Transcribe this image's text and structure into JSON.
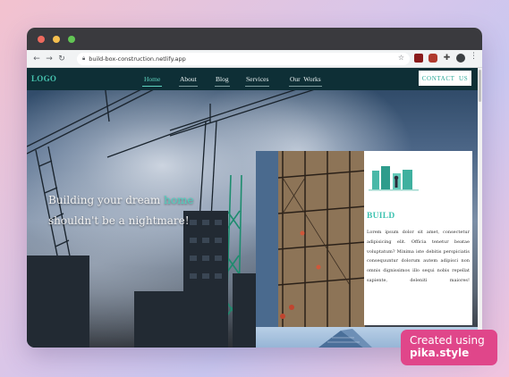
{
  "browser": {
    "url": "build-box-construction.netlify.app",
    "icons": [
      "back-icon",
      "forward-icon",
      "reload-icon",
      "lock-icon",
      "star-icon",
      "extensions-icon",
      "profile-icon",
      "menu-icon"
    ]
  },
  "nav": {
    "logo": "LOGO",
    "links": [
      {
        "label": "Home",
        "active": true
      },
      {
        "label": "About",
        "active": false
      },
      {
        "label": "Blog",
        "active": false
      },
      {
        "label": "Services",
        "active": false
      },
      {
        "label": "Our  Works",
        "active": false
      }
    ],
    "contact": "CONTACT  US"
  },
  "hero": {
    "line1_pre": "Building your dream ",
    "line1_accent": "home",
    "line2": "shouldn't be a nightmare!"
  },
  "card": {
    "title": "BUILD",
    "text": "Lorem ipsum dolor sit amet, consectetur adipisicing elit. Officia tenetur beatae voluptatum? Minima iste debitis perspiciatis consequuntur dolorum autem adipisci non omnis dignissimos illo sequi nobis repellat sapiente, deleniti maiores!"
  },
  "badge": {
    "line1": "Created using",
    "line2": "pika.style"
  },
  "colors": {
    "accent": "#4fd2bf",
    "navbar": "#0e2f36",
    "badge": "#e0468a"
  }
}
